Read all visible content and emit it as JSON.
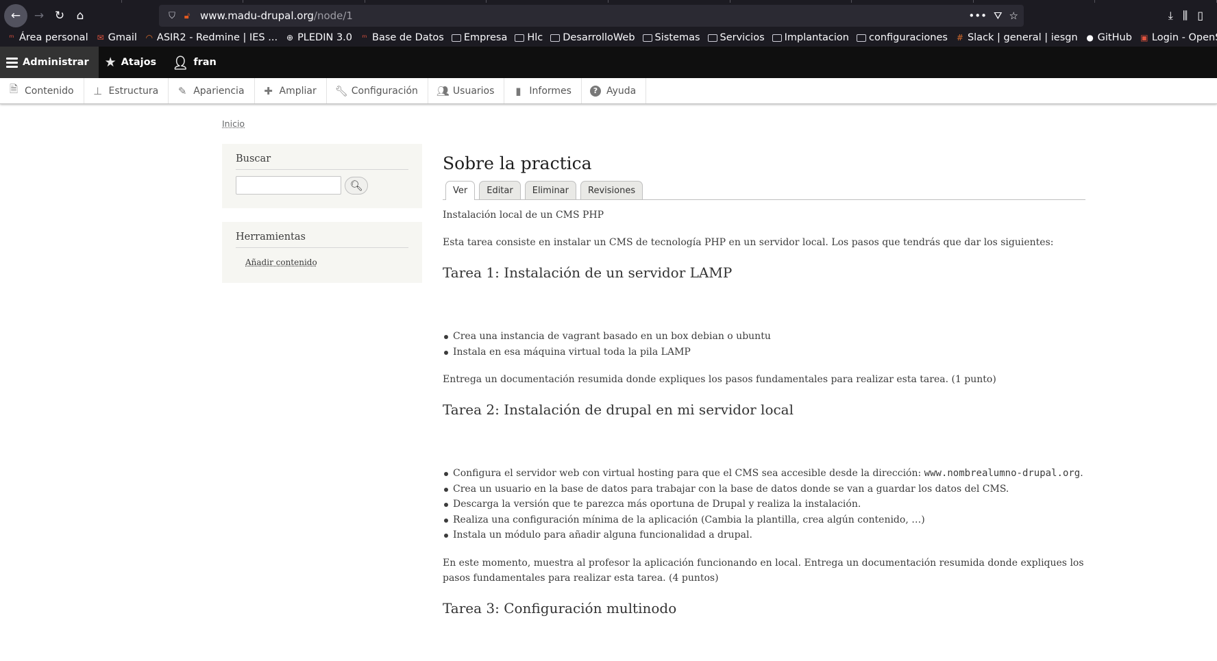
{
  "browser": {
    "url_host": "www.madu-drupal.org",
    "url_path": "/node/1",
    "bookmarks": [
      {
        "label": "Área personal",
        "icon": "moodle-icon"
      },
      {
        "label": "Gmail",
        "icon": "gmail-icon"
      },
      {
        "label": "ASIR2 - Redmine | IES ...",
        "icon": "redmine-icon"
      },
      {
        "label": "PLEDIN 3.0",
        "icon": "globe-icon"
      },
      {
        "label": "Base de Datos",
        "icon": "moodle-icon"
      },
      {
        "label": "Empresa",
        "icon": "folder-icon"
      },
      {
        "label": "Hlc",
        "icon": "folder-icon"
      },
      {
        "label": "DesarrolloWeb",
        "icon": "folder-icon"
      },
      {
        "label": "Sistemas",
        "icon": "folder-icon"
      },
      {
        "label": "Servicios",
        "icon": "folder-icon"
      },
      {
        "label": "Implantacion",
        "icon": "folder-icon"
      },
      {
        "label": "configuraciones",
        "icon": "folder-icon"
      },
      {
        "label": "Slack | general | iesgn",
        "icon": "slack-icon"
      },
      {
        "label": "GitHub",
        "icon": "github-icon"
      },
      {
        "label": "Login - OpenStack Das...",
        "icon": "openstack-icon"
      }
    ]
  },
  "toolbar": {
    "administrar": "Administrar",
    "atajos": "Atajos",
    "user": "fran"
  },
  "tray": [
    {
      "label": "Contenido",
      "icon": "file-icon"
    },
    {
      "label": "Estructura",
      "icon": "sitemap-icon"
    },
    {
      "label": "Apariencia",
      "icon": "brush-icon"
    },
    {
      "label": "Ampliar",
      "icon": "puzzle-icon"
    },
    {
      "label": "Configuración",
      "icon": "wrench-icon"
    },
    {
      "label": "Usuarios",
      "icon": "people-icon"
    },
    {
      "label": "Informes",
      "icon": "bar-chart-icon"
    },
    {
      "label": "Ayuda",
      "icon": "help-icon"
    }
  ],
  "breadcrumb": "Inicio",
  "sidebar": {
    "search_title": "Buscar",
    "tools_title": "Herramientas",
    "tools_link": "Añadir contenido"
  },
  "node": {
    "title": "Sobre la practica",
    "tabs": [
      "Ver",
      "Editar",
      "Eliminar",
      "Revisiones"
    ],
    "intro": "Instalación local de un CMS PHP",
    "para1": "Esta tarea consiste en instalar un CMS de tecnología PHP en un servidor local. Los pasos que tendrás que dar los siguientes:",
    "task1_title": "Tarea 1: Instalación de un servidor LAMP",
    "task1_items": [
      "Crea una instancia de vagrant basado en un box debian o ubuntu",
      "Instala en esa máquina virtual toda la pila LAMP"
    ],
    "task1_note": "Entrega un documentación resumida donde expliques los pasos fundamentales para realizar esta tarea. (1 punto)",
    "task2_title": "Tarea 2: Instalación de drupal en mi servidor local",
    "task2_item1_text": "Configura el servidor web con virtual hosting para que el CMS sea accesible desde la dirección: ",
    "task2_item1_code": "www.nombrealumno-drupal.org",
    "task2_item1_end": ".",
    "task2_items": [
      "Crea un usuario en la base de datos para trabajar con la base de datos donde se van a guardar los datos del CMS.",
      "Descarga la versión que te parezca más oportuna de Drupal y realiza la instalación.",
      "Realiza una configuración mínima de la aplicación (Cambia la plantilla, crea algún contenido, …)",
      "Instala un módulo para añadir alguna funcionalidad a drupal."
    ],
    "task2_note": "En este momento, muestra al profesor la aplicación funcionando en local. Entrega un documentación resumida donde expliques los pasos fundamentales para realizar esta tarea. (4 puntos)",
    "task3_title": "Tarea 3: Configuración multinodo"
  }
}
